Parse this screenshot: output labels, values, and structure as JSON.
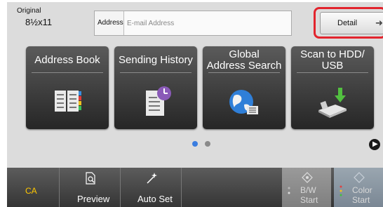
{
  "original": {
    "label": "Original",
    "size": "8½x11"
  },
  "address": {
    "label": "Address",
    "placeholder": "E-mail Address"
  },
  "detail": {
    "label": "Detail"
  },
  "tiles": [
    {
      "label": "Address Book"
    },
    {
      "label": "Sending History"
    },
    {
      "label_line1": "Global",
      "label_line2": "Address Search"
    },
    {
      "label_line1": "Scan to HDD/",
      "label_line2": "USB"
    }
  ],
  "bottom": {
    "ca": "CA",
    "preview": "Preview",
    "auto_set": "Auto Set",
    "bw_line1": "B/W",
    "bw_line2": "Start",
    "color_line1": "Color",
    "color_line2": "Start"
  },
  "colors": {
    "accent_highlight": "#e2242d",
    "page_indicator_active": "#3a7de0",
    "ca_text": "#ffc800"
  }
}
